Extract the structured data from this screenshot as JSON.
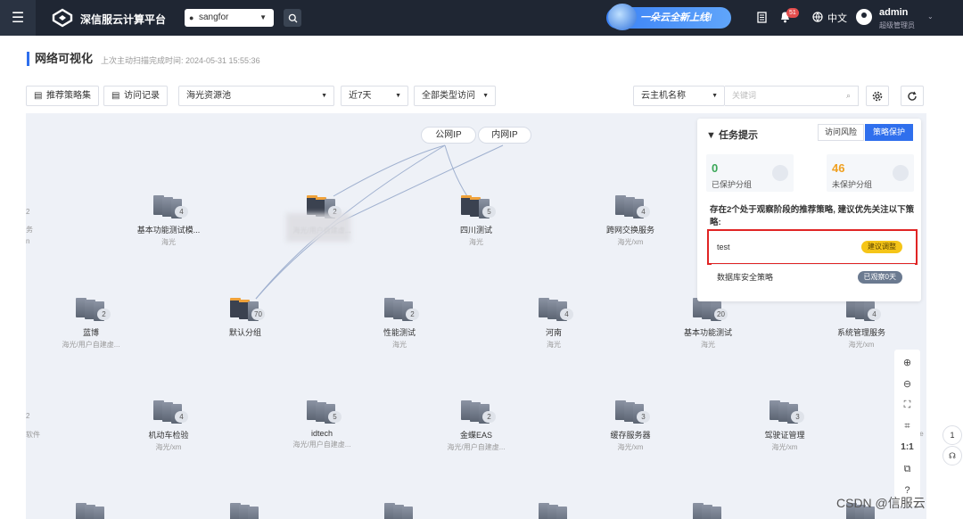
{
  "topbar": {
    "brand": "深信服云计算平台",
    "region": "sangfor",
    "banner": "一朵云全新上线!",
    "notification_count": "51",
    "language": "中文",
    "user_name": "admin",
    "user_role": "超级管理员"
  },
  "header": {
    "title": "网络可视化",
    "scan_time": "上次主动扫描完成时间: 2024-05-31 15:55:36"
  },
  "toolbar": {
    "recommend_button": "推荐策略集",
    "access_log_button": "访问记录",
    "pool_select": "海光资源池",
    "range_select": "近7天",
    "type_select": "全部类型访问",
    "field_select": "云主机名称",
    "keyword_placeholder": "关键词"
  },
  "canvas": {
    "pills": [
      "公网IP",
      "内网IP"
    ],
    "nodes": [
      {
        "name": "基本功能测试模...",
        "count": "4",
        "sub": "海光"
      },
      {
        "name": "",
        "count": "2",
        "sub": "海光/用户自建虚..."
      },
      {
        "name": "四川测试",
        "count": "5",
        "sub": "海光"
      },
      {
        "name": "跨网交换服务",
        "count": "4",
        "sub": "海光/xm"
      },
      {
        "name": "蓝博",
        "count": "2",
        "sub": "海光/用户自建虚..."
      },
      {
        "name": "默认分组",
        "count": "70",
        "sub": ""
      },
      {
        "name": "性能测试",
        "count": "2",
        "sub": "海光"
      },
      {
        "name": "河南",
        "count": "4",
        "sub": "海光"
      },
      {
        "name": "基本功能测试",
        "count": "20",
        "sub": "海光"
      },
      {
        "name": "系统管理服务",
        "count": "4",
        "sub": "海光/xm"
      },
      {
        "name": "机动车检验",
        "count": "4",
        "sub": "海光/xm"
      },
      {
        "name": "idtech",
        "count": "5",
        "sub": "海光/用户自建虚..."
      },
      {
        "name": "金蝶EAS",
        "count": "2",
        "sub": "海光/用户自建虚..."
      },
      {
        "name": "缓存服务器",
        "count": "3",
        "sub": "海光/xm"
      },
      {
        "name": "驾驶证管理",
        "count": "3",
        "sub": "海光/xm"
      }
    ],
    "edge_left": [
      "2",
      "务",
      "n",
      "2",
      "软件"
    ],
    "edge_right": [
      "1",
      "te"
    ]
  },
  "task_panel": {
    "title": "任务提示",
    "tab_risk": "访问风险",
    "tab_policy": "策略保护",
    "protected_count": "0",
    "protected_label": "已保护分组",
    "unprotected_count": "46",
    "unprotected_label": "未保护分组",
    "notice": "存在2个处于观察阶段的推荐策略, 建议优先关注以下策略:",
    "policies": [
      {
        "name": "test",
        "tag": "建议调整"
      },
      {
        "name": "数据库安全策略",
        "tag": "已观察0天"
      }
    ]
  },
  "tools": {
    "ratio": "1:1"
  },
  "float_badge": "1",
  "watermark": "CSDN @信服云",
  "colors": {
    "accent": "#2f6fed",
    "topbar": "#1f2633",
    "highlight": "#e02424",
    "warning": "#f5c518",
    "unprotected": "#f0a020",
    "protected": "#3aa757"
  }
}
